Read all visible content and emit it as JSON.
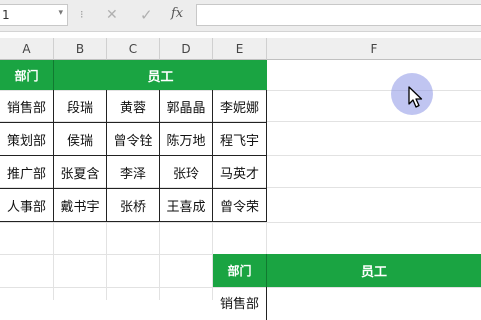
{
  "formula_bar": {
    "name_box_value": "1",
    "name_box_arrow": "▾",
    "separator": "⁝",
    "cancel_symbol": "✕",
    "enter_symbol": "✓",
    "fx_label": "fx",
    "formula_value": ""
  },
  "columns": [
    "A",
    "B",
    "C",
    "D",
    "E",
    "F"
  ],
  "table1": {
    "header_dept": "部门",
    "header_staff": "员工",
    "rows": [
      [
        "销售部",
        "段瑞",
        "黄蓉",
        "郭晶晶",
        "李妮娜"
      ],
      [
        "策划部",
        "侯瑞",
        "曾令铨",
        "陈万地",
        "程飞宇"
      ],
      [
        "推广部",
        "张夏含",
        "李泽",
        "张玲",
        "马英才"
      ],
      [
        "人事部",
        "戴书宇",
        "张桥",
        "王喜成",
        "曾令荣"
      ]
    ]
  },
  "table2": {
    "header_dept": "部门",
    "header_staff": "员工",
    "partial_row_label": "销售部"
  },
  "colors": {
    "header_green": "#1aa442",
    "cursor_halo": "#8c96e6"
  },
  "icons": {
    "cursor": "mouse-pointer-icon"
  }
}
